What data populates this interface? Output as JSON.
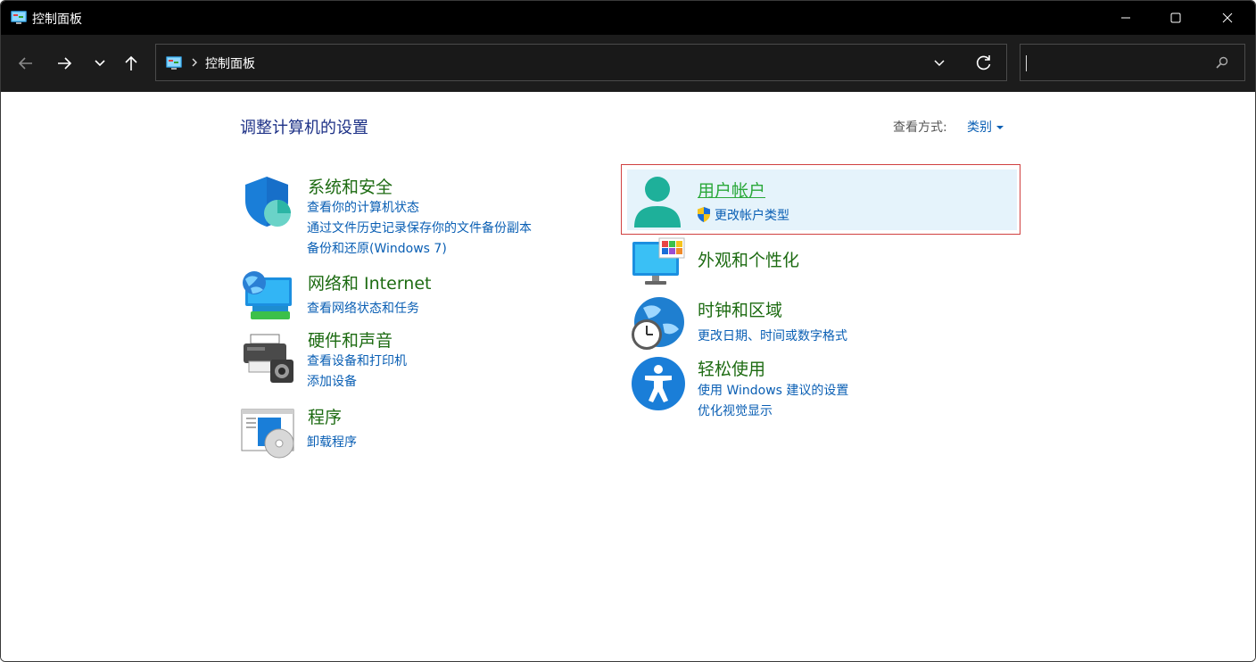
{
  "window": {
    "title": "控制面板"
  },
  "address_bar": {
    "crumb": "控制面板",
    "search_placeholder": ""
  },
  "main": {
    "heading": "调整计算机的设置",
    "view_by_label": "查看方式:",
    "view_by_value": "类别"
  },
  "left_column": [
    {
      "title": "系统和安全",
      "icon": "shield-icon",
      "links": [
        "查看你的计算机状态",
        "通过文件历史记录保存你的文件备份副本",
        "备份和还原(Windows 7)"
      ]
    },
    {
      "title": "网络和 Internet",
      "icon": "network-icon",
      "links": [
        "查看网络状态和任务"
      ]
    },
    {
      "title": "硬件和声音",
      "icon": "printer-icon",
      "links": [
        "查看设备和打印机",
        "添加设备"
      ]
    },
    {
      "title": "程序",
      "icon": "programs-icon",
      "links": [
        "卸载程序"
      ]
    }
  ],
  "right_column": [
    {
      "title": "用户帐户",
      "icon": "user-icon",
      "links": [
        "更改帐户类型"
      ],
      "highlighted": true
    },
    {
      "title": "外观和个性化",
      "icon": "monitor-icon",
      "links": []
    },
    {
      "title": "时钟和区域",
      "icon": "clock-globe-icon",
      "links": [
        "更改日期、时间或数字格式"
      ]
    },
    {
      "title": "轻松使用",
      "icon": "accessibility-icon",
      "links": [
        "使用 Windows 建议的设置",
        "优化视觉显示"
      ]
    }
  ],
  "colors": {
    "title_text": "#1d6b12",
    "link": "#0a5fb4",
    "heading": "#1e3287",
    "highlight_border": "#d04040",
    "highlight_bg": "#e5f3fb"
  }
}
